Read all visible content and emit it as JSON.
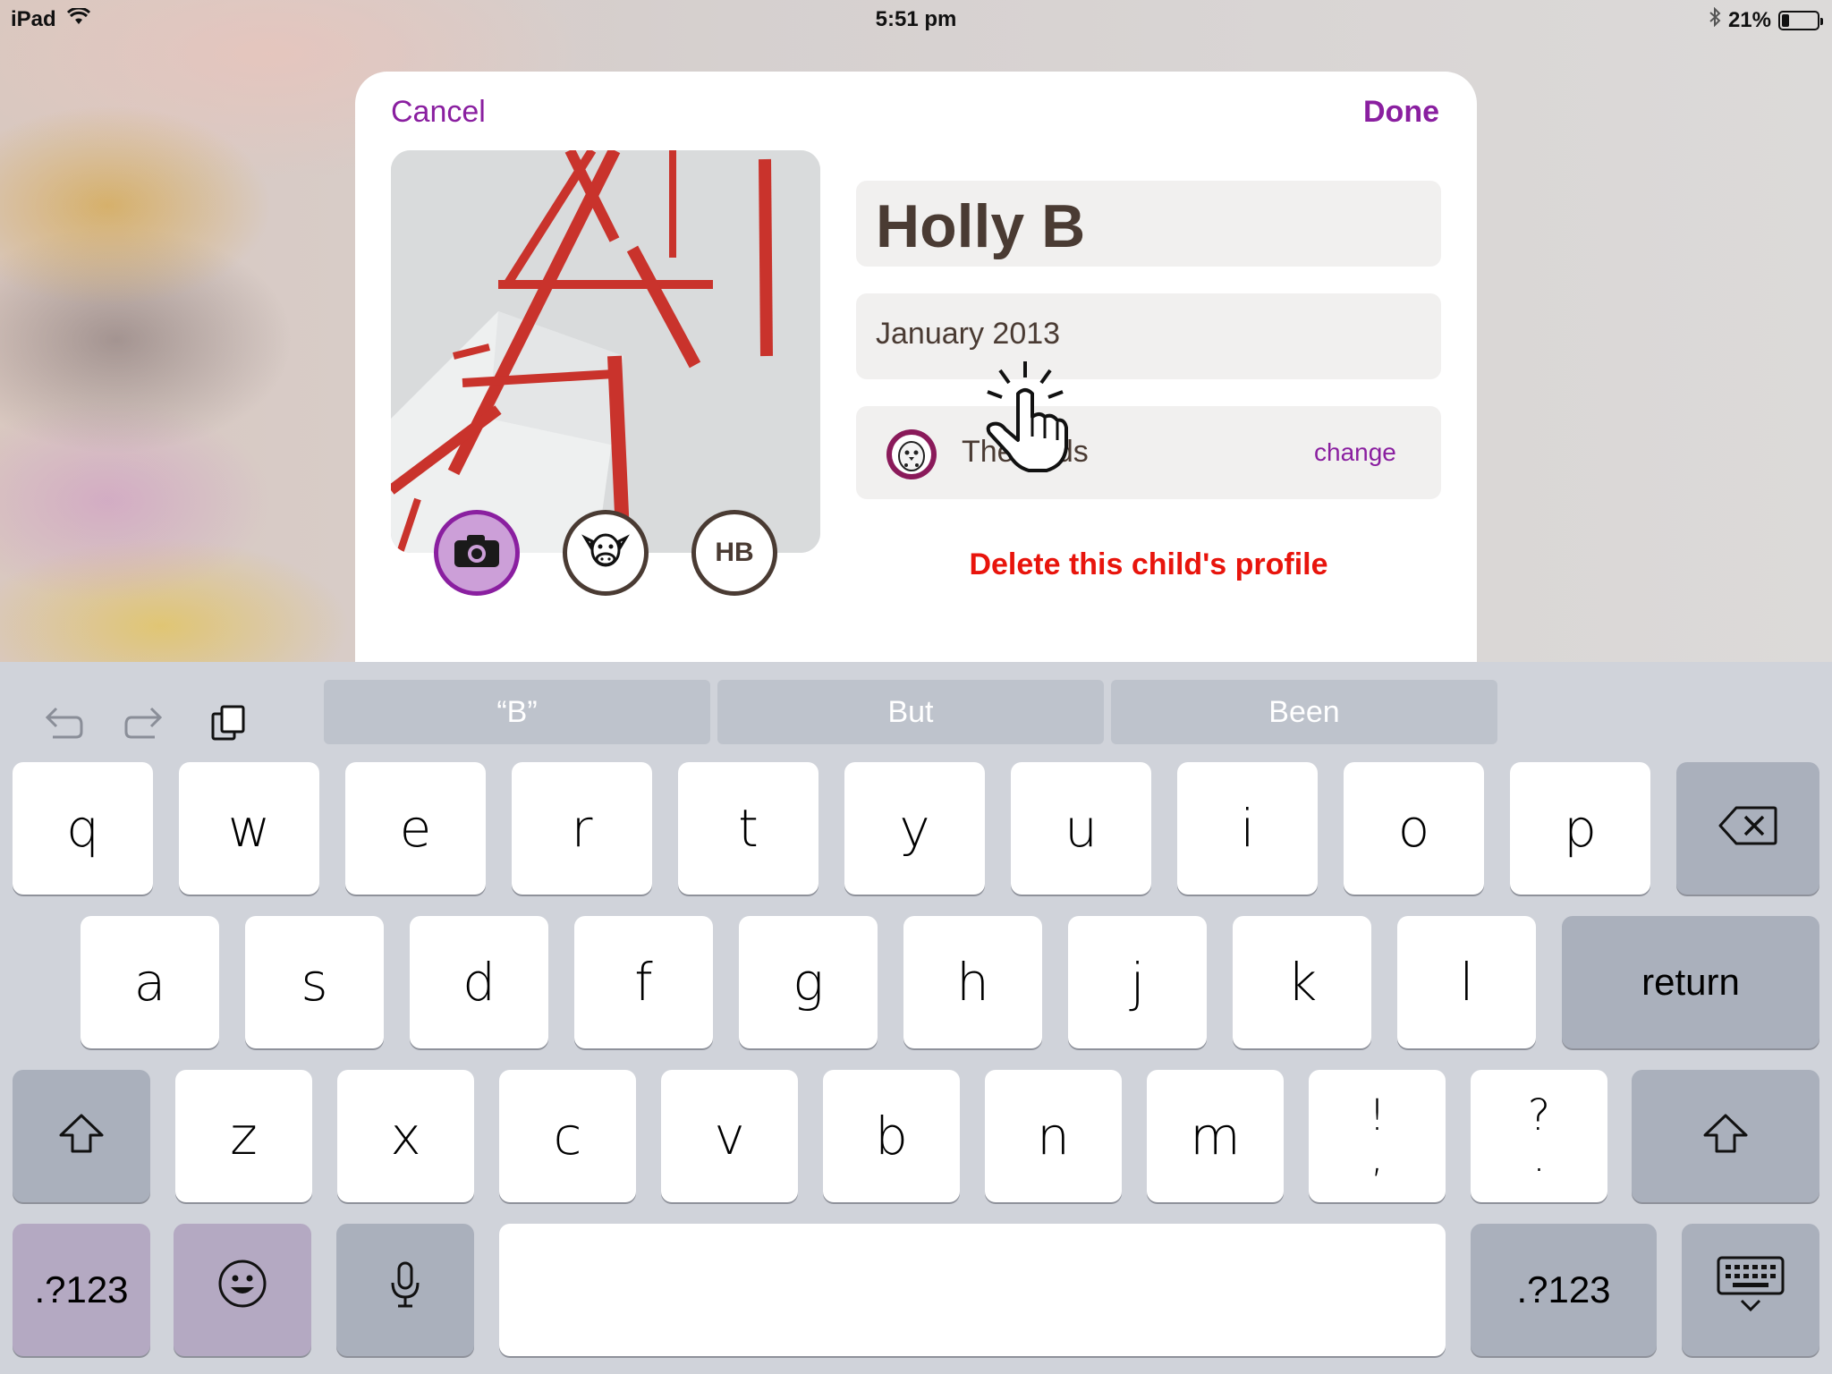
{
  "status_bar": {
    "device": "iPad",
    "time": "5:51 pm",
    "battery": "21%",
    "battery_level": 0.21
  },
  "modal": {
    "cancel_label": "Cancel",
    "done_label": "Done",
    "name": "Holly B",
    "birth_date": "January 2013",
    "group_name": "The birds",
    "group_change_label": "change",
    "initials": "HB",
    "delete_label": "Delete this child's profile"
  },
  "keyboard": {
    "suggestions": [
      "“B”",
      "But",
      "Been"
    ],
    "row1": [
      "q",
      "w",
      "e",
      "r",
      "t",
      "y",
      "u",
      "i",
      "o",
      "p"
    ],
    "row2": [
      "a",
      "s",
      "d",
      "f",
      "g",
      "h",
      "j",
      "k",
      "l"
    ],
    "row3": [
      "z",
      "x",
      "c",
      "v",
      "b",
      "n",
      "m"
    ],
    "punct1": [
      "!",
      ","
    ],
    "punct2": [
      "?",
      "."
    ],
    "return_label": "return",
    "numbers_label": ".?123"
  },
  "colors": {
    "accent": "#8a1fa0",
    "text_brown": "#4a3b33",
    "delete_red": "#e8140c"
  },
  "icons": [
    "wifi-icon",
    "bluetooth-icon",
    "battery-icon",
    "camera-icon",
    "cow-icon",
    "bird-icon",
    "hand-pointer-icon",
    "undo-icon",
    "redo-icon",
    "paste-icon",
    "backspace-icon",
    "shift-icon",
    "emoji-icon",
    "microphone-icon",
    "keyboard-dismiss-icon"
  ]
}
